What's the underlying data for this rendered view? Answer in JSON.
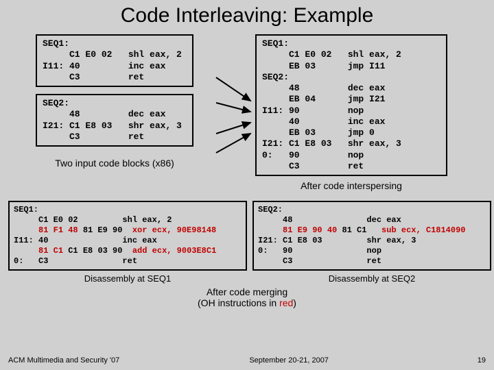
{
  "title": "Code Interleaving: Example",
  "seq1": "SEQ1:\n     C1 E0 02   shl eax, 2\nI11: 40         inc eax\n     C3         ret",
  "seq2": "SEQ2:\n     48         dec eax\nI21: C1 E8 03   shr eax, 3\n     C3         ret",
  "input_caption": "Two input code blocks (x86)",
  "interspersed": "SEQ1:\n     C1 E0 02   shl eax, 2\n     EB 03      jmp I11\nSEQ2:\n     48         dec eax\n     EB 04      jmp I21\nI11: 90         nop\n     40         inc eax\n     EB 03      jmp 0\nI21: C1 E8 03   shr eax, 3\n0:   90         nop\n     C3         ret",
  "intersperse_caption": "After code interspersing",
  "dis1": {
    "prefix": "SEQ1:\n     C1 E0 02         shl eax, 2\n     ",
    "r1a": "81 F1 48 ",
    "r1b": "81 E9 90",
    "r1c": "  xor ecx, 90E98148\n",
    "mid": "I11: 40               inc eax\n     ",
    "r2a": "81 C1 ",
    "r2b": "C1 E8 03 90",
    "r2c": "  add ecx, 9003E8C1\n",
    "tail": "0:   C3               ret"
  },
  "dis1_caption": "Disassembly at SEQ1",
  "dis2": {
    "prefix": "SEQ2:\n     48               dec eax\n     ",
    "r1a": "81 E9 90 40 ",
    "r1b": "81 C1",
    "r1c": "   sub ecx, C1814090\n",
    "mid": "I21: C1 E8 03         shr eax, 3\n0:   90               nop\n     C3               ret",
    "tail": ""
  },
  "dis2_caption": "Disassembly at SEQ2",
  "merge_caption_a": "After code merging",
  "merge_caption_b": "(OH instructions in ",
  "merge_caption_c": "red",
  "merge_caption_d": ")",
  "footer_left": "ACM Multimedia and Security '07",
  "footer_right": "September 20-21, 2007",
  "footer_page": "19"
}
